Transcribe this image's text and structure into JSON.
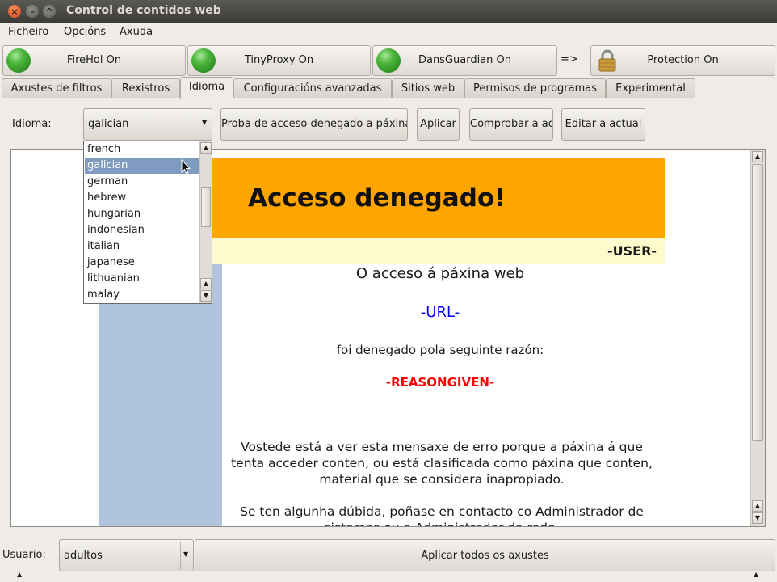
{
  "window": {
    "title": "Control de contidos web"
  },
  "menu": [
    "Ficheiro",
    "Opcións",
    "Axuda"
  ],
  "services": [
    {
      "label": "FireHol On"
    },
    {
      "label": "TinyProxy On"
    },
    {
      "label": "DansGuardian On"
    }
  ],
  "arrow_text": "=>",
  "protection": {
    "label": "Protection On"
  },
  "tabs": [
    "Axustes de filtros",
    "Rexistros",
    "Idioma",
    "Configuracións avanzadas",
    "Sitios web",
    "Permisos de programas",
    "Experimental"
  ],
  "language": {
    "label": "Idioma:",
    "selected": "galician",
    "options": [
      "french",
      "galician",
      "german",
      "hebrew",
      "hungarian",
      "indonesian",
      "italian",
      "japanese",
      "lithuanian",
      "malay"
    ]
  },
  "buttons": {
    "test": "Proba de acceso denegado a páxina",
    "apply": "Aplicar",
    "check": "Comprobar a actual",
    "edit": "Editar a actual"
  },
  "preview": {
    "heading": "Acceso denegado!",
    "user": "-USER-",
    "line1": "O acceso á páxina web",
    "url": "-URL-",
    "line2": "foi denegado pola seguinte razón:",
    "reason": "-REASONGIVEN-",
    "para1": "Vostede está a ver esta mensaxe de erro porque a páxina á que tenta acceder conten, ou está clasificada como páxina que conten, material que se considera inapropiado.",
    "para2": "Se ten algunha dúbida, poñase en contacto co Administrador de sistemas ou o Administrador da rede."
  },
  "footer": {
    "user_label": "Usuario:",
    "user_value": "adultos",
    "apply_all": "Aplicar todos os axustes"
  },
  "colors": {
    "banner": "#ffa500",
    "user_bar": "#fffacd",
    "sidebar": "#b0c4de",
    "reason": "#ff0000",
    "link": "#0000ee",
    "selection": "#7f9bbf"
  }
}
